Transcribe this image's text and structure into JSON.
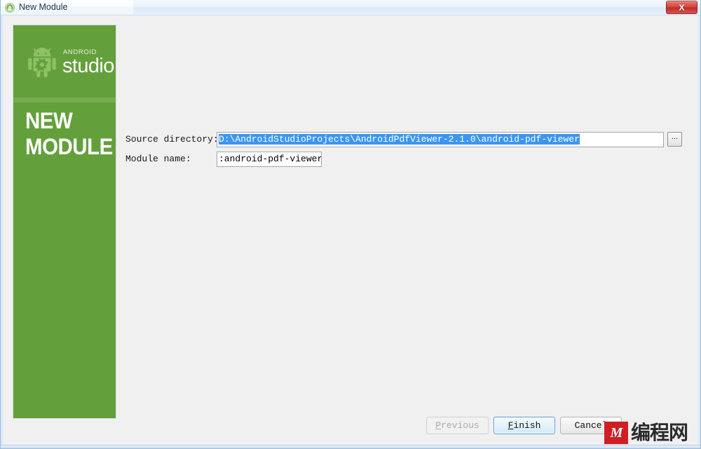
{
  "window": {
    "title": "New Module",
    "icon": "android-icon",
    "close_label": "X"
  },
  "side_panel": {
    "wordmark_small": "ANDROID",
    "wordmark_large": "studio",
    "heading_line1": "NEW",
    "heading_line2": "MODULE",
    "background_color": "#63a03c",
    "divider_color": "#76ab50",
    "robot_color": "#8fc063"
  },
  "form": {
    "source_directory": {
      "label": "Source directory:",
      "value": "D:\\AndroidStudioProjects\\AndroidPdfViewer-2.1.0\\android-pdf-viewer",
      "selected": true,
      "selection_color": "#3c96f0",
      "browse_label": "..."
    },
    "module_name": {
      "label": "Module name:",
      "value": ":android-pdf-viewer"
    }
  },
  "footer": {
    "buttons": [
      {
        "name": "previous",
        "label": "Previous",
        "mnemonic": "P",
        "enabled": false,
        "default": false
      },
      {
        "name": "finish",
        "label": "Finish",
        "mnemonic": "F",
        "enabled": true,
        "default": true
      },
      {
        "name": "cancel",
        "label": "Cancel",
        "mnemonic": "",
        "enabled": true,
        "default": false
      }
    ]
  },
  "watermark": {
    "badge": "M",
    "text": "编程网",
    "badge_color": "#cf1f22"
  }
}
